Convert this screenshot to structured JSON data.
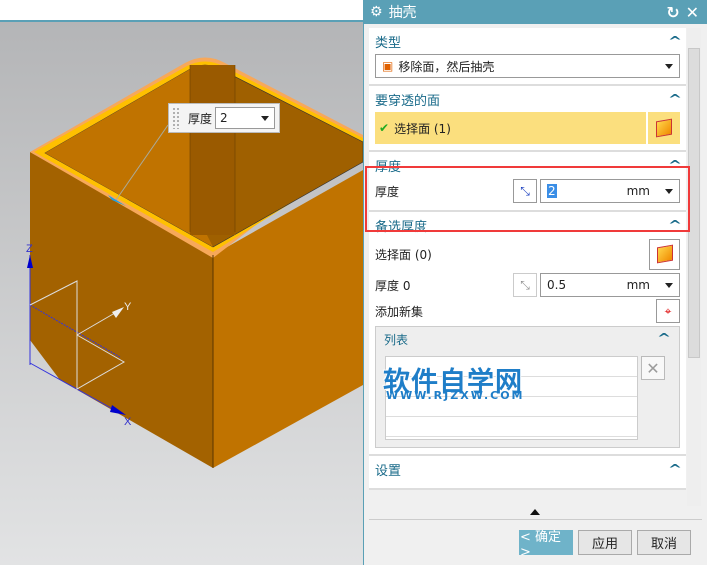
{
  "viewport": {
    "dim_label": "厚度",
    "dim_value": "2",
    "axes": {
      "x": "X",
      "y": "Y",
      "z": "Z"
    }
  },
  "dialog": {
    "title": "抽壳",
    "type_section": {
      "title": "类型",
      "value": "移除面，然后抽壳"
    },
    "pierce_section": {
      "title": "要穿透的面",
      "select_label": "选择面 (1)"
    },
    "thickness_section": {
      "title": "厚度",
      "label": "厚度",
      "value": "2",
      "unit": "mm"
    },
    "alt_section": {
      "title": "备选厚度",
      "select_label": "选择面 (0)",
      "thickness_label": "厚度 0",
      "thickness_value": "0.5",
      "unit": "mm",
      "add_set": "添加新集",
      "list_title": "列表"
    },
    "settings_section": {
      "title": "设置"
    },
    "buttons": {
      "ok": "< 确定 >",
      "apply": "应用",
      "cancel": "取消"
    }
  },
  "watermark": {
    "title": "软件自学网",
    "url": "WWW.RJZXW.COM"
  }
}
